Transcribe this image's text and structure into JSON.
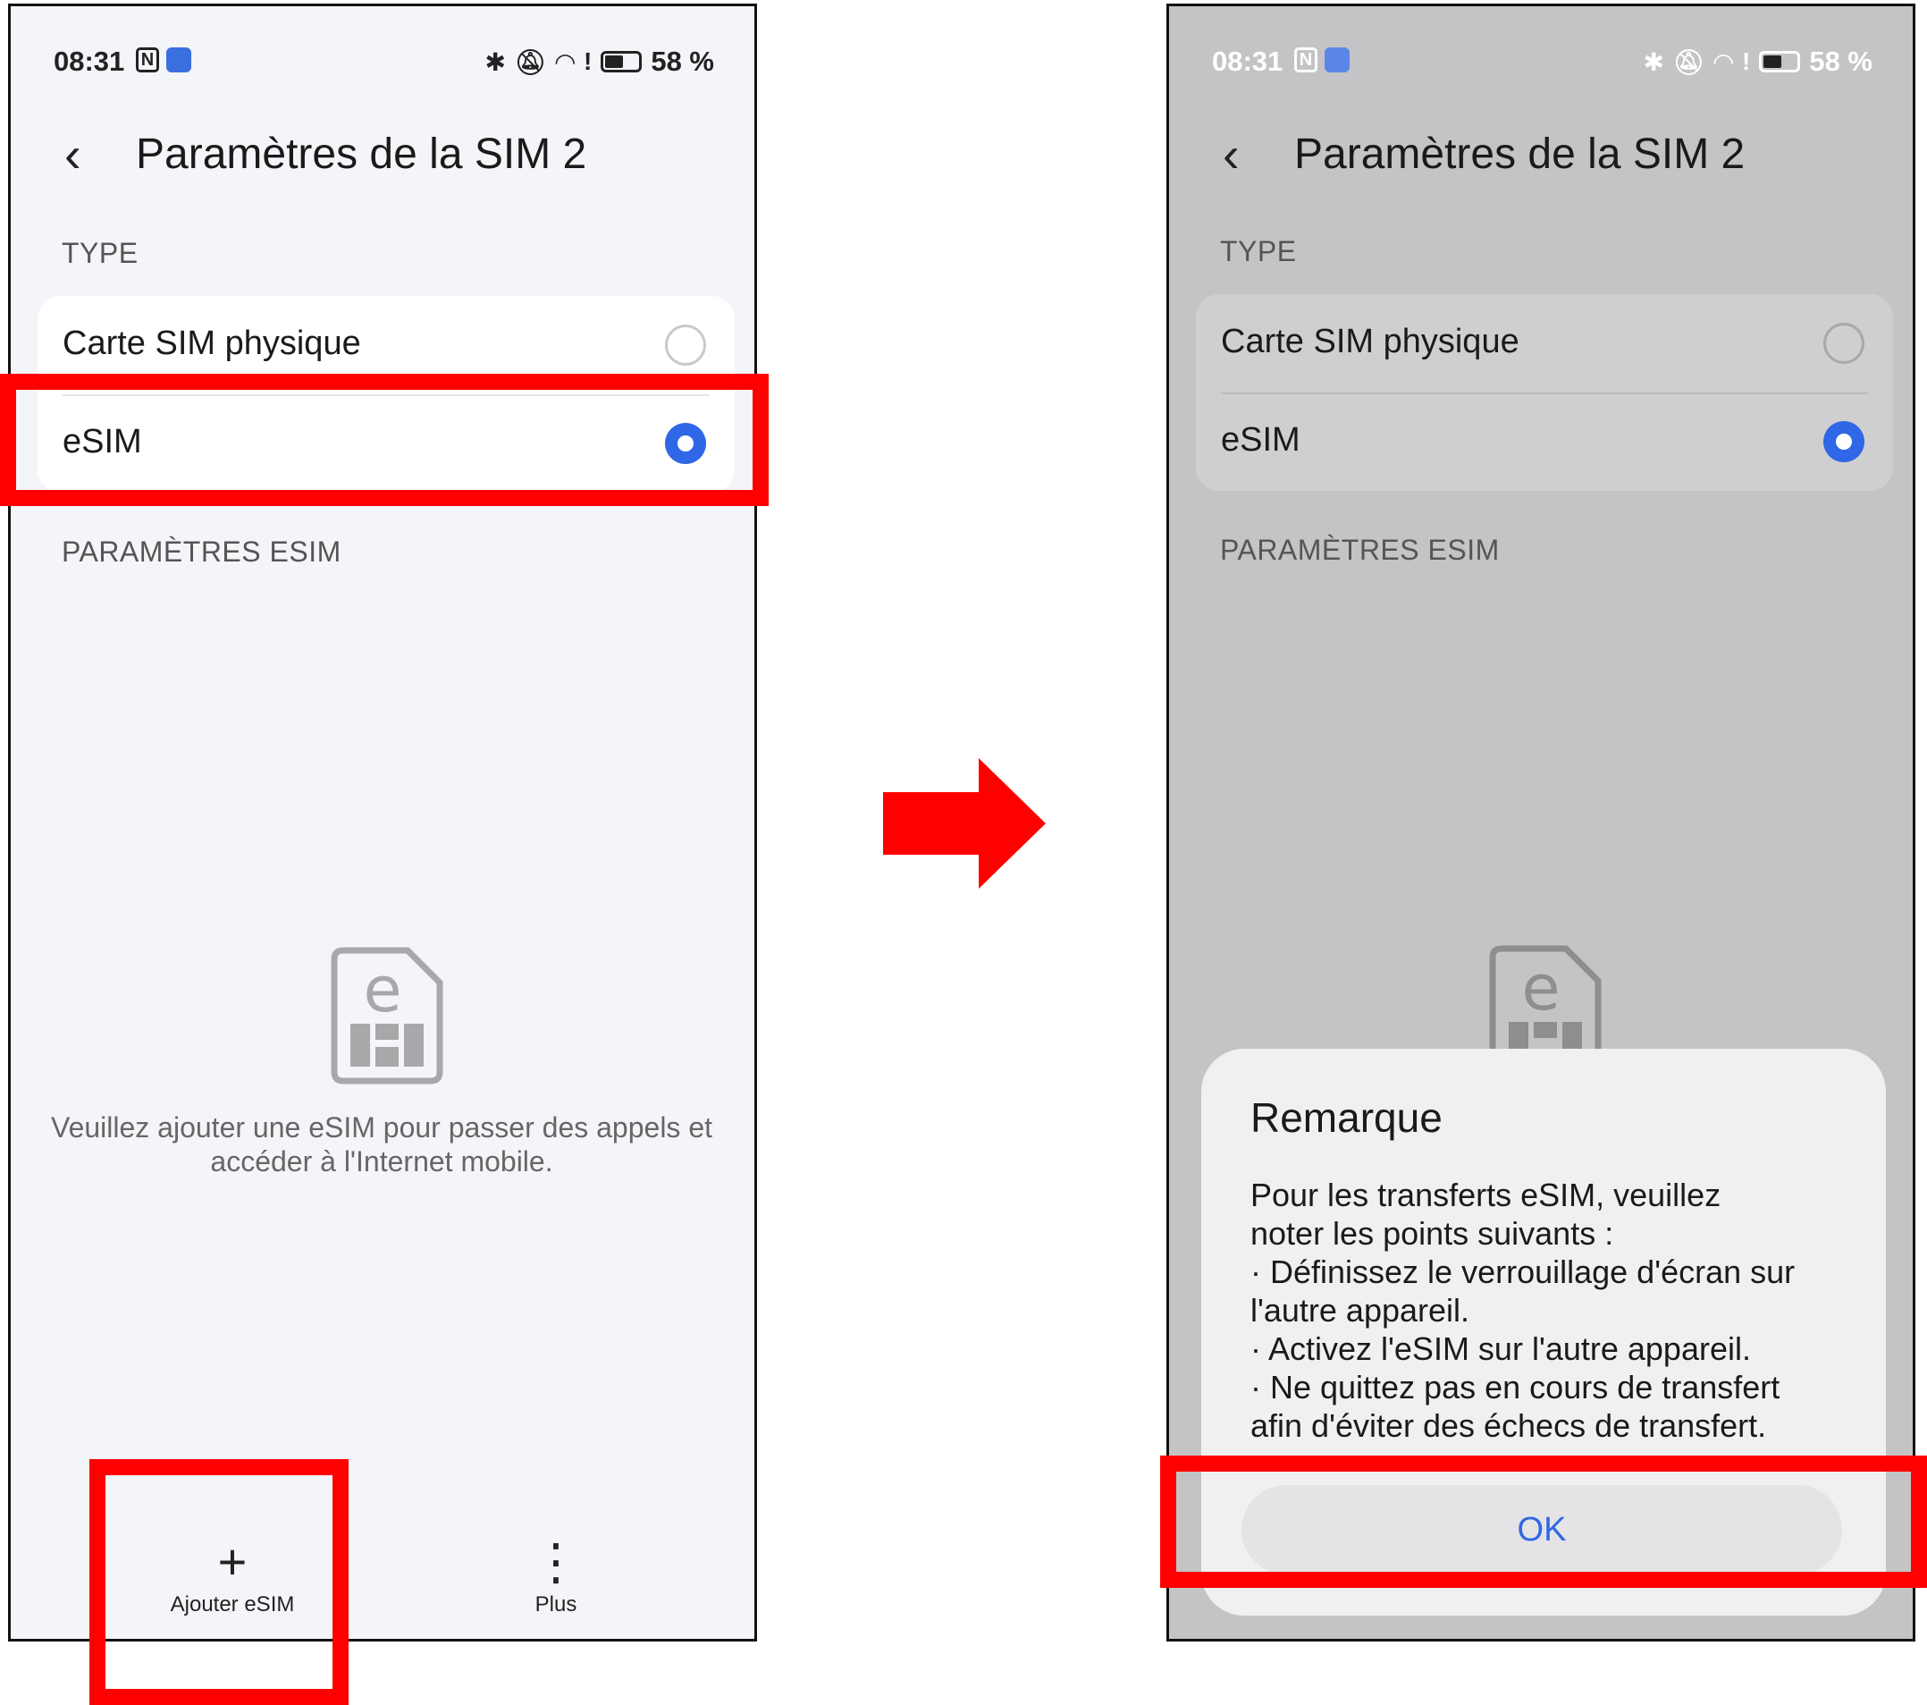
{
  "left_screen": {
    "status": {
      "time": "08:31",
      "battery": "58 %"
    },
    "header": {
      "back_glyph": "‹",
      "title": "Paramètres de la SIM 2"
    },
    "type_label": "TYPE",
    "options": [
      {
        "label": "Carte SIM physique",
        "selected": false
      },
      {
        "label": "eSIM",
        "selected": true
      }
    ],
    "esim_settings_label": "PARAMÈTRES ESIM",
    "empty_message": "Veuillez ajouter une eSIM pour passer des appels et accéder à l'Internet mobile.",
    "bottom": {
      "add_icon": "+",
      "add_label": "Ajouter eSIM",
      "more_icon": "⋮",
      "more_label": "Plus"
    }
  },
  "right_screen": {
    "status": {
      "time": "08:31",
      "battery": "58 %"
    },
    "header": {
      "back_glyph": "‹",
      "title": "Paramètres de la SIM 2"
    },
    "type_label": "TYPE",
    "options": [
      {
        "label": "Carte SIM physique",
        "selected": false
      },
      {
        "label": "eSIM",
        "selected": true
      }
    ],
    "esim_settings_label": "PARAMÈTRES ESIM",
    "dialog": {
      "title": "Remarque",
      "body_lines": [
        "Pour les transferts eSIM, veuillez",
        "noter les points suivants :",
        "· Définissez le verrouillage d'écran sur",
        "l'autre appareil.",
        "· Activez l'eSIM sur l'autre appareil.",
        "· Ne quittez pas en cours de transfert",
        "afin d'éviter des échecs de transfert."
      ],
      "ok_label": "OK"
    }
  },
  "status_icons": [
    "nfc-icon",
    "note-icon",
    "bluetooth-icon",
    "mute-icon",
    "wifi-icon",
    "alert-icon",
    "battery-icon"
  ],
  "colors": {
    "highlight_red": "#ff0000",
    "accent_blue": "#2f67e6"
  }
}
